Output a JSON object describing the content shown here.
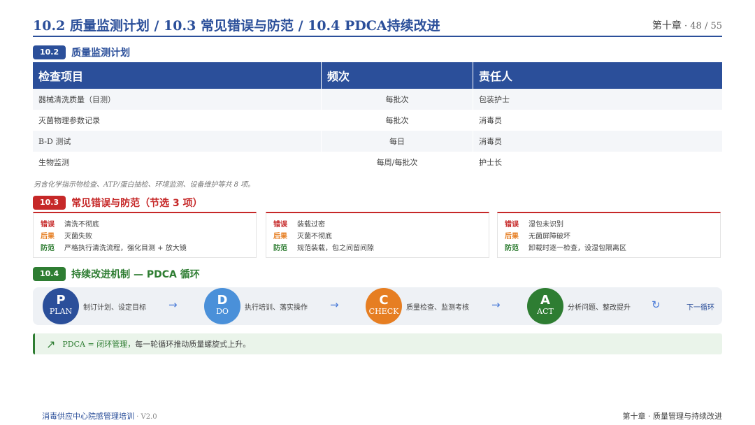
{
  "header": {
    "title": "10.2 质量监测计划 / 10.3 常见错误与防范 / 10.4 PDCA持续改进",
    "chapter": "第十章",
    "sep": " · ",
    "page": "48 / 55"
  },
  "sections": {
    "s102": {
      "badge": "10.2",
      "title": "质量监测计划",
      "color": "#2b4f9a"
    },
    "s103": {
      "badge": "10.3",
      "title": "常见错误与防范（节选 3 项）",
      "color": "#c62828"
    },
    "s104": {
      "badge": "10.4",
      "title": "持续改进机制 — PDCA 循环",
      "color": "#2e7d32"
    }
  },
  "table": {
    "headers": [
      "检查项目",
      "频次",
      "责任人"
    ],
    "rows": [
      [
        "器械清洗质量（目测）",
        "每批次",
        "包装护士"
      ],
      [
        "灭菌物理参数记录",
        "每批次",
        "消毒员"
      ],
      [
        "B-D 测试",
        "每日",
        "消毒员"
      ],
      [
        "生物监测",
        "每周/每批次",
        "护士长"
      ]
    ]
  },
  "note": "另含化学指示物检查、ATP/蛋白抽检、环境监测、设备维护等共 8 项。",
  "labels": {
    "error": "错误",
    "result": "后果",
    "prevent": "防范"
  },
  "errors": [
    {
      "error": "清洗不彻底",
      "result": "灭菌失败",
      "prevent": "严格执行清洗流程，强化目测 + 放大镜"
    },
    {
      "error": "装载过密",
      "result": "灭菌不彻底",
      "prevent": "规范装载，包之间留间隙"
    },
    {
      "error": "湿包未识别",
      "result": "无菌屏障破坏",
      "prevent": "卸载时逐一检查，设湿包隔离区"
    }
  ],
  "pdca": {
    "steps": [
      {
        "letter": "P",
        "word": "PLAN",
        "text": "制订计划、设定目标",
        "color": "#2b4f9a"
      },
      {
        "letter": "D",
        "word": "DO",
        "text": "执行培训、落实操作",
        "color": "#4a90d9"
      },
      {
        "letter": "C",
        "word": "CHECK",
        "text": "质量检查、监测考核",
        "color": "#e67e22"
      },
      {
        "letter": "A",
        "word": "ACT",
        "text": "分析问题、整改提升",
        "color": "#2e7d32"
      }
    ],
    "arrow": "→",
    "cycle_icon": "↻",
    "next": "下一循环"
  },
  "summary": {
    "icon": "↗",
    "highlight": "PDCA = 闭环管理，",
    "rest": "每一轮循环推动质量螺旋式上升。"
  },
  "footer": {
    "left": "消毒供应中心院感管理培训",
    "version": " · V2.0",
    "right": "第十章 · 质量管理与持续改进"
  }
}
